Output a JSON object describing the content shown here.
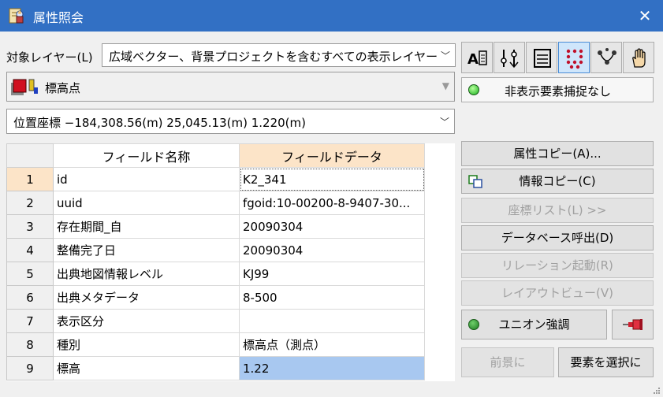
{
  "window": {
    "title": "属性照会",
    "close_glyph": "✕"
  },
  "target_layer": {
    "label": "対象レイヤー(L)",
    "value": "広域ベクター、背景プロジェクトを含むすべての表示レイヤー"
  },
  "layer_select": {
    "value": "標高点"
  },
  "coord_select": {
    "value": "位置座標 −184,308.56(m) 25,045.13(m) 1.220(m)"
  },
  "toolbar": {
    "icons": [
      "attribute-text-icon",
      "attribute-filter-icon",
      "attribute-panel-icon",
      "dots-pattern-icon",
      "node-graph-icon",
      "hand-icon"
    ],
    "active_index": 3
  },
  "capture_status": {
    "label": "非表示要素捕捉なし",
    "indicator_color": "#19b21e"
  },
  "table": {
    "headers": [
      "フィールド名称",
      "フィールドデータ"
    ],
    "rows": [
      {
        "num": "1",
        "field": "id",
        "value": "K2_341"
      },
      {
        "num": "2",
        "field": "uuid",
        "value": "fgoid:10-00200-8-9407-30..."
      },
      {
        "num": "3",
        "field": "存在期間_自",
        "value": "20090304"
      },
      {
        "num": "4",
        "field": "整備完了日",
        "value": "20090304"
      },
      {
        "num": "5",
        "field": "出典地図情報レベル",
        "value": "KJ99"
      },
      {
        "num": "6",
        "field": "出典メタデータ",
        "value": "8-500"
      },
      {
        "num": "7",
        "field": "表示区分",
        "value": ""
      },
      {
        "num": "8",
        "field": "種別",
        "value": "標高点（測点）"
      },
      {
        "num": "9",
        "field": "標高",
        "value": "1.22"
      }
    ],
    "current_row_header": "1",
    "selected_value_row": "9",
    "header_highlight_color": "#fce4c8",
    "selection_color": "#a8c8f0"
  },
  "buttons": {
    "copy_attr": "属性コピー(A)...",
    "copy_info": "情報コピー(C)",
    "coord_list": "座標リスト(L) >>",
    "db_call": "データベース呼出(D)",
    "relation": "リレーション起動(R)",
    "layout_view": "レイアウトビュー(V)",
    "union_highlight": "ユニオン強調",
    "foreground": "前景に",
    "select_element": "要素を選択に"
  }
}
